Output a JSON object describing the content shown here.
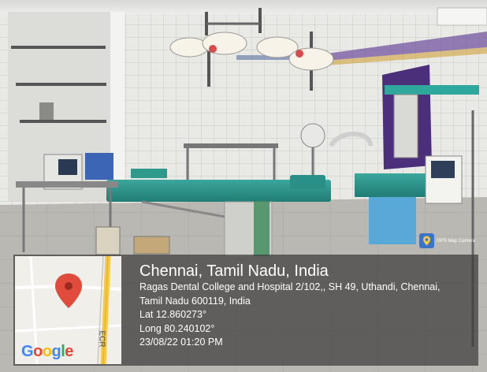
{
  "photo": {
    "subject": "hospital operating theatre"
  },
  "gps_stamp": {
    "location_title": "Chennai, Tamil Nadu, India",
    "address_line_1": "Ragas Dental College and Hospital 2/102,, SH 49, Uthandi, Chennai,",
    "address_line_2": "Tamil Nadu 600119, India",
    "latitude": "Lat 12.860273°",
    "longitude": "Long 80.240102°",
    "datetime": "23/08/22 01:20 PM",
    "app_badge": "GPS Map Camera",
    "map": {
      "brand": "Google",
      "road_label": "ECR",
      "pin_icon": "location-pin-icon",
      "colors": {
        "pin": "#e04b3c",
        "road": "#f6c945",
        "land": "#f1efe9"
      }
    }
  }
}
